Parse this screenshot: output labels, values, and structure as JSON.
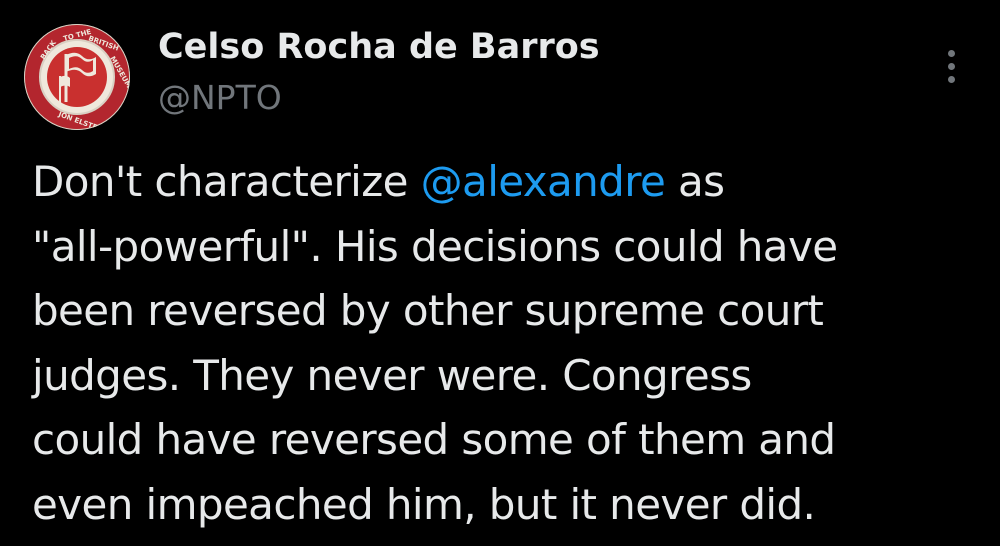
{
  "author": {
    "display_name": "Celso Rocha de Barros",
    "handle": "@NPTO",
    "avatar_text": "BACK TO THE BRITISH MUSEUM · JON ELSTER"
  },
  "menu": {
    "icon": "more-vertical-icon"
  },
  "tweet": {
    "lines": [
      {
        "before": "Don't characterize ",
        "mention": "@alexandre",
        "after": " as"
      },
      {
        "text": "\"all-powerful\". His decisions could have"
      },
      {
        "text": "been reversed by other supreme court"
      },
      {
        "text": "judges. They never were. Congress"
      },
      {
        "text": "could have reversed some of them and"
      },
      {
        "text": "even impeached him, but it never did."
      }
    ]
  },
  "colors": {
    "background": "#000000",
    "text": "#e7e9ea",
    "secondary": "#71767b",
    "link": "#1d9bf0",
    "avatar_red": "#b3262e"
  }
}
